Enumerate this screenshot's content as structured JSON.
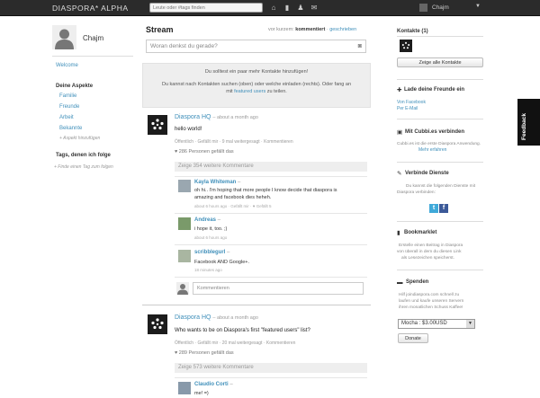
{
  "topbar": {
    "brand": "DIASPORA* ALPHA",
    "search_placeholder": "Leute oder #tags finden",
    "user_name": "Chajm"
  },
  "left": {
    "user_name": "Chajm",
    "welcome": "Welcome",
    "aspects_title": "Deine Aspekte",
    "aspects": [
      "Familie",
      "Freunde",
      "Arbeit",
      "Bekannte"
    ],
    "add_aspect": "+ Aspekt hinzufügen",
    "tags_title": "Tags, denen ich folge",
    "tags_find": "+ Finde einen Tag zum folgen"
  },
  "stream": {
    "title": "Stream",
    "sort_prefix": "vor kurzem:",
    "sort_active": "kommentiert",
    "sort_sep": "·",
    "sort_other": "geschrieben",
    "publisher_placeholder": "Woran denkst du gerade?",
    "notice_line1": "Du solltest ein paar mehr Kontakte hinzufügen!",
    "notice_line2": "Du kannst nach Kontakten suchen (oben) oder welche einladen (rechts). Oder fang an",
    "notice_line3_prefix": "mit ",
    "notice_line3_link": "featured users",
    "notice_line3_suffix": " zu teilen."
  },
  "posts": [
    {
      "author": "Diaspora HQ",
      "time": "– about a month ago",
      "text": "hello world!",
      "actions": "Öffentlich · Gefällt mir · 9 mal weitergesagt · Kommentieren",
      "likes": "286 Personen gefällt das",
      "more_comments": "Zeige 354 weitere Kommentare",
      "comments": [
        {
          "author": "Kayla Whiteman",
          "dash": "–",
          "lines": [
            "oh hi.. I'm hoping that more people I know decide that diaspora is",
            "amazing and facebook dies heheh."
          ],
          "meta": "about 6 hours ago · Gefällt mir · ♥ Gefällt 5"
        },
        {
          "author": "Andreas",
          "dash": "–",
          "lines": [
            "i hope it, too. ;)"
          ],
          "meta": "about 6 hours ago"
        },
        {
          "author": "scribblegurl",
          "dash": "–",
          "lines": [
            "Facebook AND Google+."
          ],
          "meta": "18 minutes ago"
        }
      ],
      "comment_placeholder": "Kommentieren"
    },
    {
      "author": "Diaspora HQ",
      "time": "– about a month ago",
      "text": "Who wants to be on Diaspora's first \"featured users\" list?",
      "actions": "Öffentlich · Gefällt mir · 20 mal weitergesagt · Kommentieren",
      "likes": "289 Personen gefällt das",
      "more_comments": "Zeige 573 weitere Kommentare",
      "comments": [
        {
          "author": "Claudio Corti",
          "dash": "–",
          "lines": [
            "me! =)"
          ],
          "meta": ""
        }
      ]
    }
  ],
  "right": {
    "contacts_title": "Kontakte (1)",
    "contacts_button": "Zeige alle Kontakte",
    "invite_title": "Lade deine Freunde ein",
    "invite_links": [
      "Von Facebook",
      "Per E-Mail"
    ],
    "cubbies_title": "Mit Cubbi.es verbinden",
    "cubbies_text": "Cubbi.es ist die erste Diaspora Anwendung.",
    "cubbies_link": "Mehr erfahren",
    "services_title": "Verbinde Dienste",
    "services_text": [
      "Du kannst die folgenden Dienste mit",
      "Diaspora verbinden:"
    ],
    "bookmarklet_title": "Bookmarklet",
    "bookmarklet_text": [
      "Erstelle einen Beitrag in Diaspora",
      "von überall in dem du diesen Link",
      "als Lesezeichen speicherst."
    ],
    "bookmarklet_link_word": "diesen Link",
    "donate_title": "Spenden",
    "donate_text": [
      "Hilf joindiaspora.com schnell zu",
      "laufen und kaufe unseren Servern",
      "ihren monatlichen Schuss Kaffee!"
    ],
    "donate_select": "Mocha : $3.00USD",
    "donate_button": "Donate"
  },
  "feedback_label": "Feedback",
  "colors": {
    "link": "#3f8fba",
    "topbar": "#2b2b2b",
    "notice_bg": "#eeeeee"
  }
}
